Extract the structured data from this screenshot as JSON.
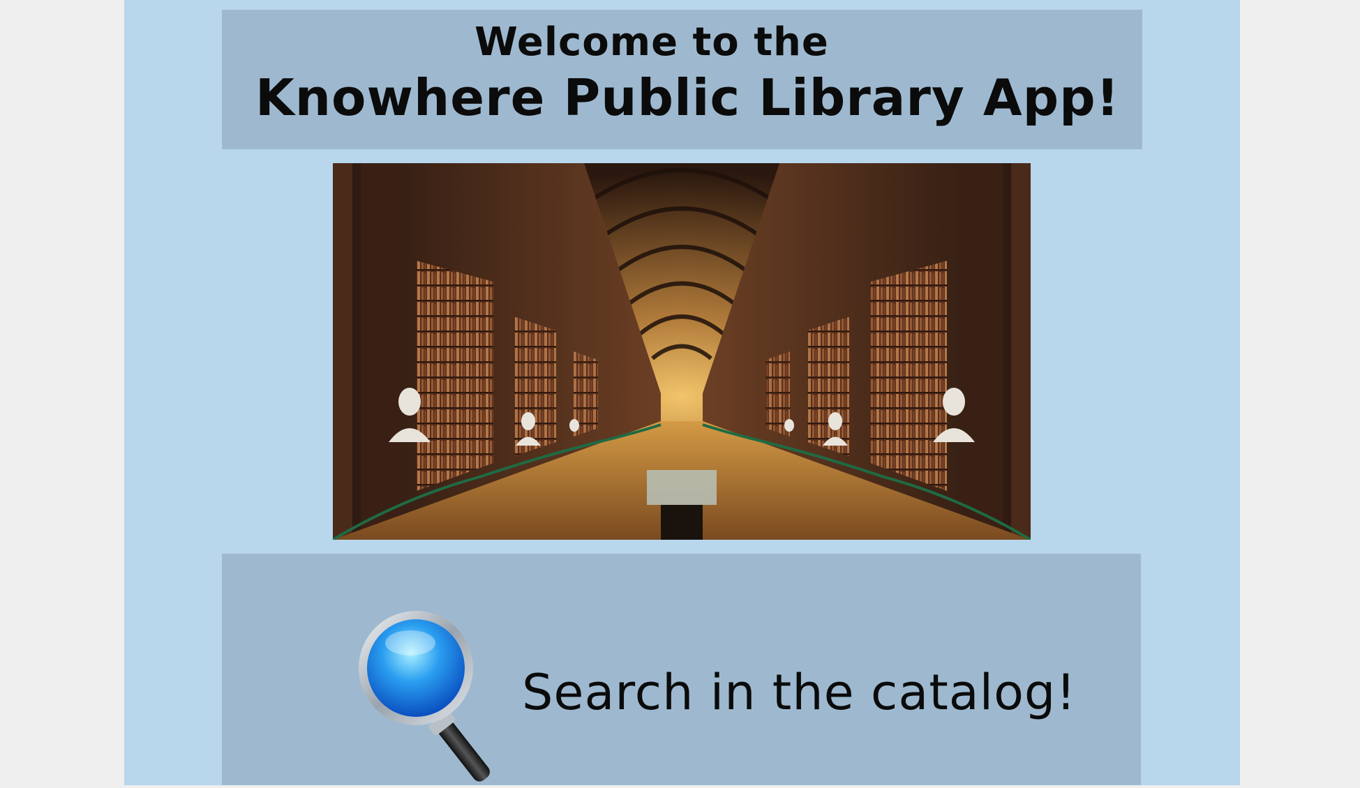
{
  "header": {
    "welcome_line": "Welcome to the",
    "app_name": "Knowhere Public Library App!"
  },
  "hero": {
    "image": "library-long-room-photo"
  },
  "search": {
    "icon": "magnifying-glass-icon",
    "label": "Search in the catalog!"
  },
  "colors": {
    "page_background": "#b8d6ec",
    "panel_background": "#9eb9cf",
    "outer_background": "#efefef",
    "text": "#0b0b0b"
  }
}
